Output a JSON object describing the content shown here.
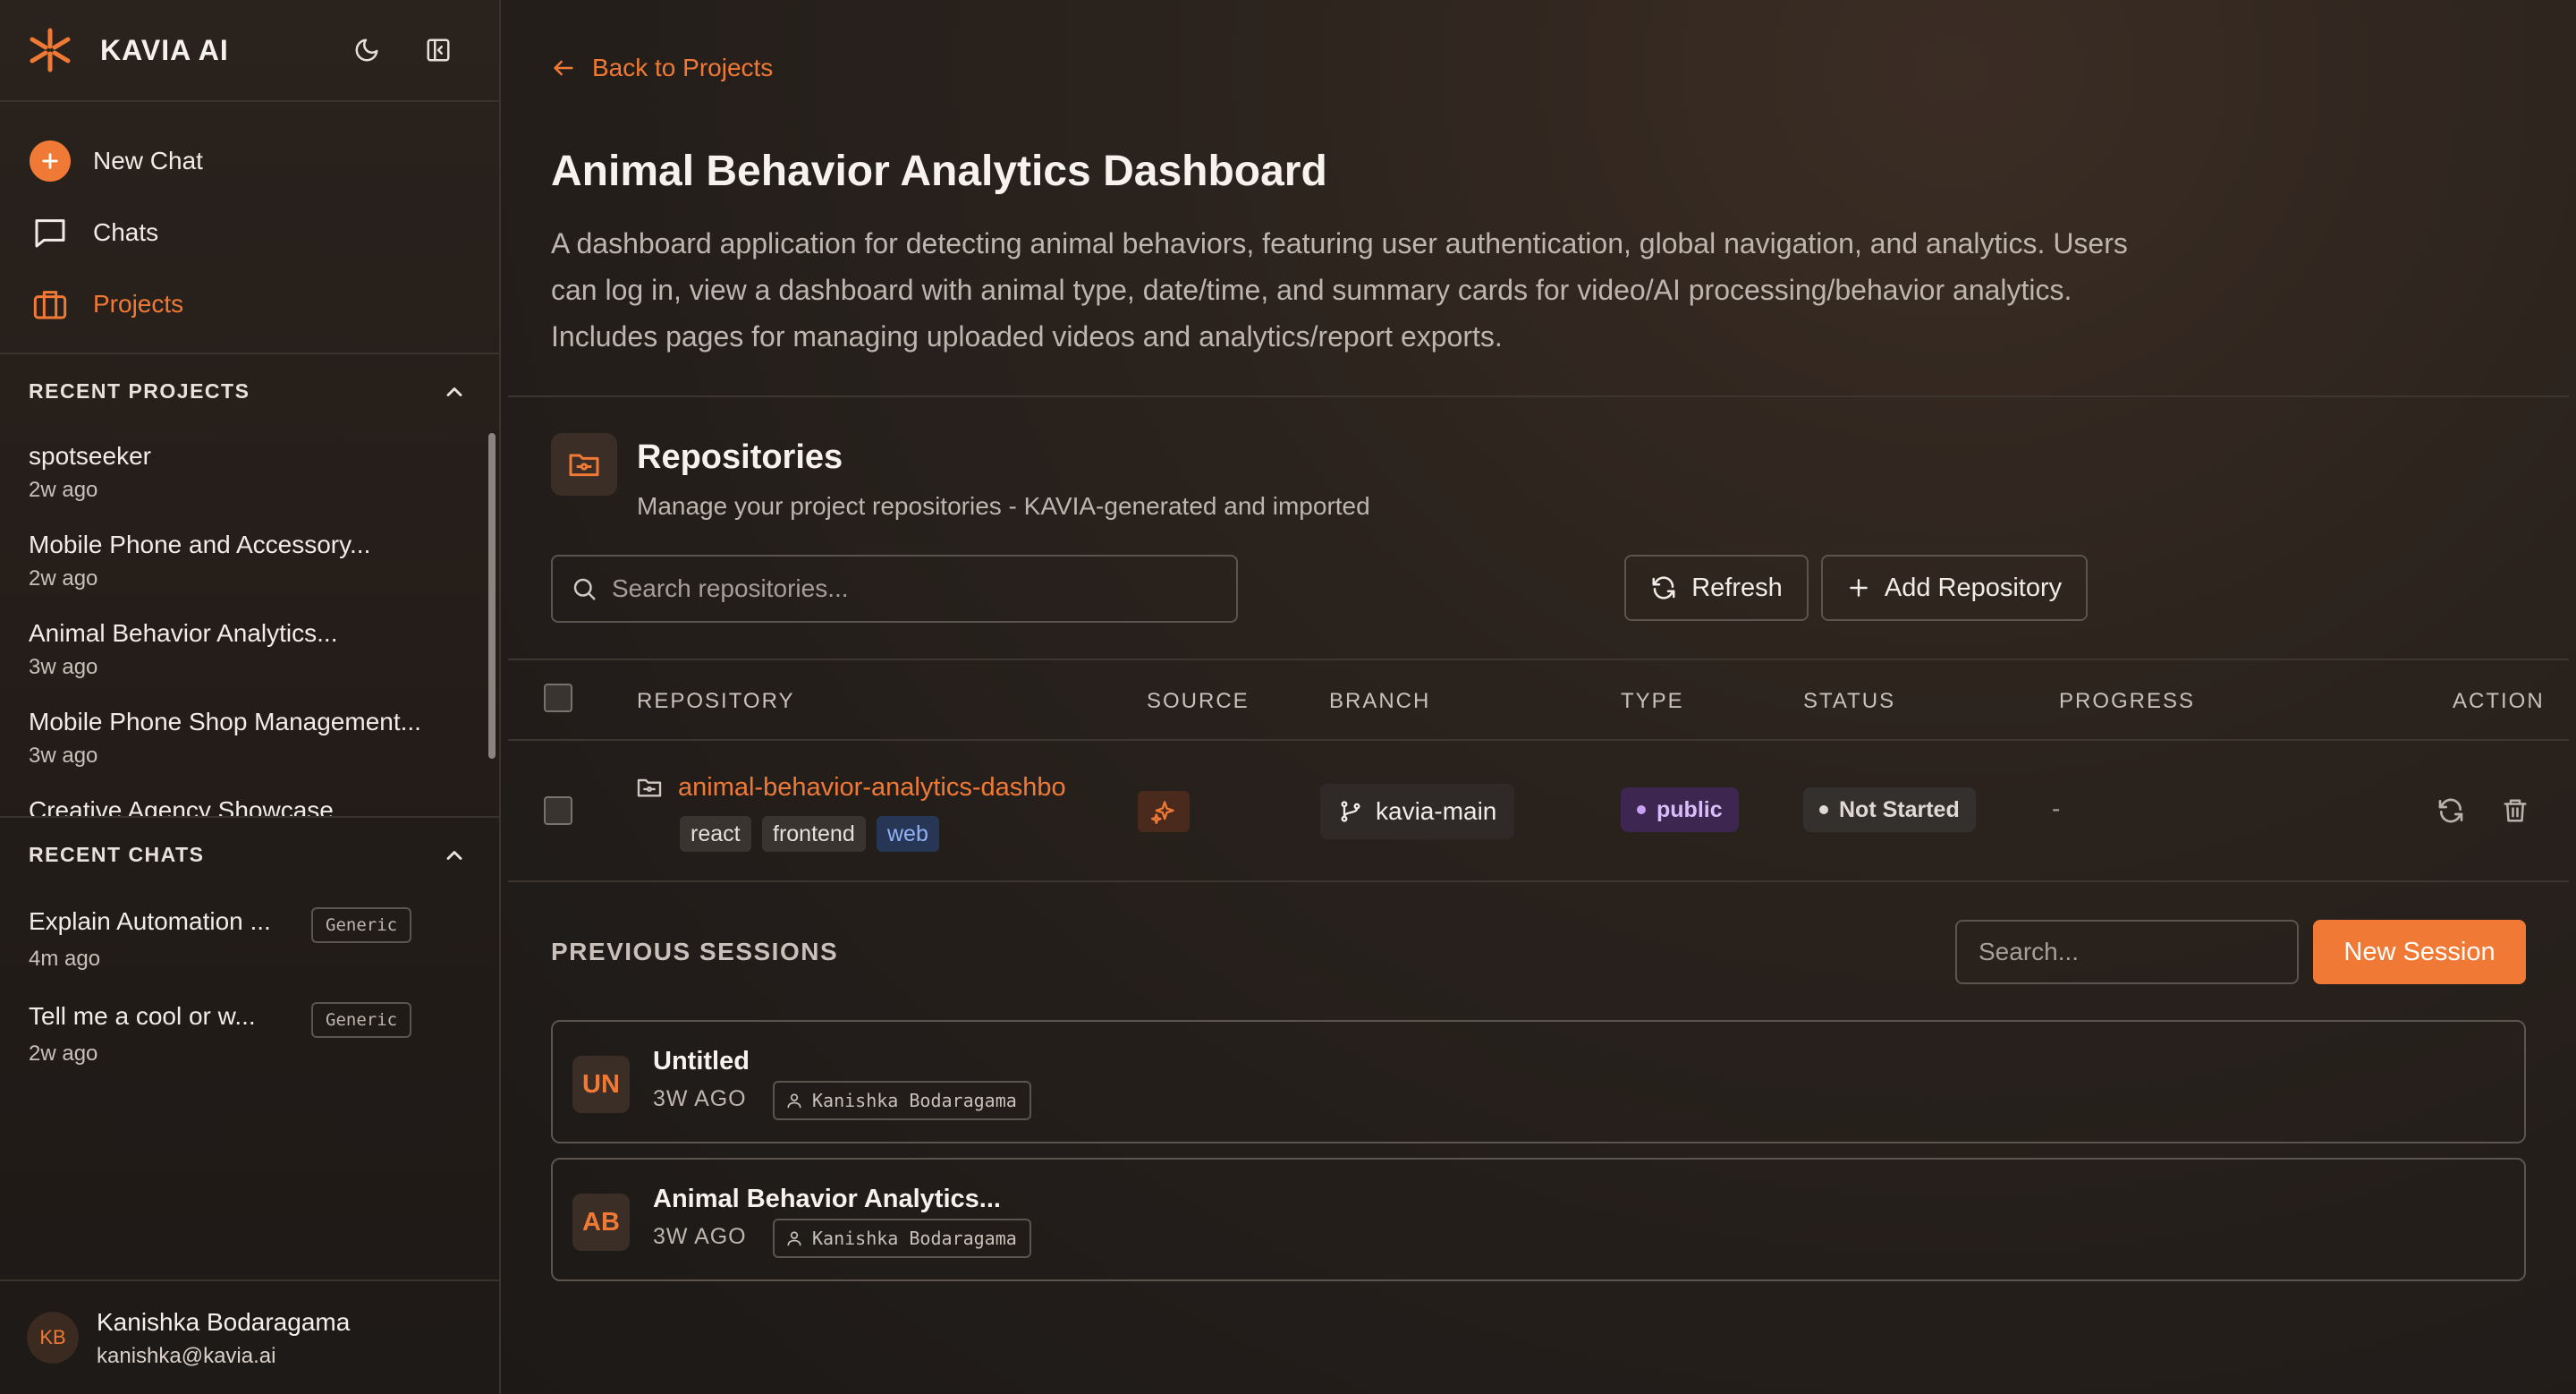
{
  "app": {
    "brand": "KAVIA AI",
    "accent": "#f07a35"
  },
  "sidebar": {
    "nav": [
      {
        "label": "New Chat",
        "icon": "plus-icon"
      },
      {
        "label": "Chats",
        "icon": "chat-icon"
      },
      {
        "label": "Projects",
        "icon": "briefcase-icon",
        "active": true
      }
    ],
    "recent_projects": {
      "title": "RECENT PROJECTS",
      "items": [
        {
          "name": "spotseeker",
          "time": "2w ago"
        },
        {
          "name": "Mobile Phone and Accessory...",
          "time": "2w ago"
        },
        {
          "name": "Animal Behavior Analytics...",
          "time": "3w ago"
        },
        {
          "name": "Mobile Phone Shop Management...",
          "time": "3w ago"
        },
        {
          "name": "Creative Agency Showcase",
          "time": ""
        }
      ]
    },
    "recent_chats": {
      "title": "RECENT CHATS",
      "items": [
        {
          "name": "Explain Automation ...",
          "time": "4m ago",
          "badge": "Generic"
        },
        {
          "name": "Tell me a cool or w...",
          "time": "2w ago",
          "badge": "Generic"
        }
      ]
    },
    "user": {
      "initials": "KB",
      "name": "Kanishka Bodaragama",
      "email": "kanishka@kavia.ai"
    }
  },
  "main": {
    "back_label": "Back to Projects",
    "title": "Animal Behavior Analytics Dashboard",
    "description": "A dashboard application for detecting animal behaviors, featuring user authentication, global navigation, and analytics. Users can log in, view a dashboard with animal type, date/time, and summary cards for video/AI processing/behavior analytics. Includes pages for managing uploaded videos and analytics/report exports.",
    "repositories": {
      "title": "Repositories",
      "subtitle": "Manage your project repositories - KAVIA-generated and imported",
      "search_placeholder": "Search repositories...",
      "refresh_label": "Refresh",
      "add_label": "Add Repository",
      "columns": [
        "REPOSITORY",
        "SOURCE",
        "BRANCH",
        "TYPE",
        "STATUS",
        "PROGRESS",
        "ACTION"
      ],
      "rows": [
        {
          "name": "animal-behavior-analytics-dashbo",
          "tags": [
            "react",
            "frontend",
            "web"
          ],
          "source_icon": "sparkle-icon",
          "branch": "kavia-main",
          "type": "public",
          "status": "Not Started",
          "progress": "-"
        }
      ]
    },
    "sessions": {
      "title": "PREVIOUS SESSIONS",
      "search_placeholder": "Search...",
      "new_label": "New Session",
      "items": [
        {
          "initials": "UN",
          "title": "Untitled",
          "time": "3W AGO",
          "user": "Kanishka Bodaragama"
        },
        {
          "initials": "AB",
          "title": "Animal Behavior Analytics...",
          "time": "3W AGO",
          "user": "Kanishka Bodaragama"
        }
      ]
    }
  }
}
